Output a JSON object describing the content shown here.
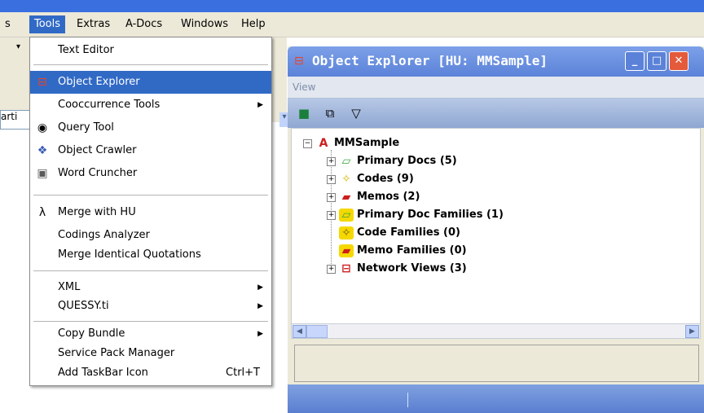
{
  "menubar": {
    "items": [
      {
        "label": "s",
        "active": false
      },
      {
        "label": "Tools",
        "active": true
      },
      {
        "label": "Extras",
        "active": false
      },
      {
        "label": "A-Docs",
        "active": false
      },
      {
        "label": "Windows",
        "active": false
      },
      {
        "label": "Help",
        "active": false
      }
    ]
  },
  "background": {
    "combo_text": "arti",
    "arrow_glyph": "▾"
  },
  "tools_menu": {
    "items": [
      {
        "label": "Text Editor",
        "icon": "none"
      },
      {
        "label": "Object Explorer",
        "icon": "object-explorer-icon",
        "highlighted": true
      },
      {
        "label": "Cooccurrence Tools",
        "icon": "none",
        "submenu": true
      },
      {
        "label": "Query Tool",
        "icon": "binoculars-icon"
      },
      {
        "label": "Object Crawler",
        "icon": "crawler-icon"
      },
      {
        "label": "Word Cruncher",
        "icon": "cruncher-icon"
      },
      {
        "label": "Merge with HU",
        "icon": "merge-icon"
      },
      {
        "label": "Codings Analyzer",
        "icon": "none"
      },
      {
        "label": "Merge Identical Quotations",
        "icon": "none"
      },
      {
        "label": "XML",
        "icon": "none",
        "submenu": true
      },
      {
        "label": "QUESSY.ti",
        "icon": "none",
        "submenu": true
      },
      {
        "label": "Copy Bundle",
        "icon": "none",
        "submenu": true
      },
      {
        "label": "Service Pack Manager",
        "icon": "none"
      },
      {
        "label": "Add TaskBar Icon",
        "icon": "none",
        "shortcut": "Ctrl+T"
      }
    ]
  },
  "object_explorer": {
    "title": "Object Explorer  [HU: MMSample]",
    "menu_view": "View",
    "root": "MMSample",
    "nodes": [
      {
        "label": "Primary Docs (5)",
        "expandable": true,
        "icon": "primary-docs-icon"
      },
      {
        "label": "Codes (9)",
        "expandable": true,
        "icon": "codes-icon"
      },
      {
        "label": "Memos (2)",
        "expandable": true,
        "icon": "memos-icon"
      },
      {
        "label": "Primary Doc Families (1)",
        "expandable": true,
        "icon": "primary-doc-families-icon"
      },
      {
        "label": "Code Families (0)",
        "expandable": false,
        "icon": "code-families-icon"
      },
      {
        "label": "Memo Families (0)",
        "expandable": false,
        "icon": "memo-families-icon"
      },
      {
        "label": "Network Views (3)",
        "expandable": true,
        "icon": "network-views-icon"
      }
    ]
  },
  "colors": {
    "highlight": "#316ac5",
    "title_blue": "#3a6fe0",
    "menu_bg": "#ece9d8"
  }
}
